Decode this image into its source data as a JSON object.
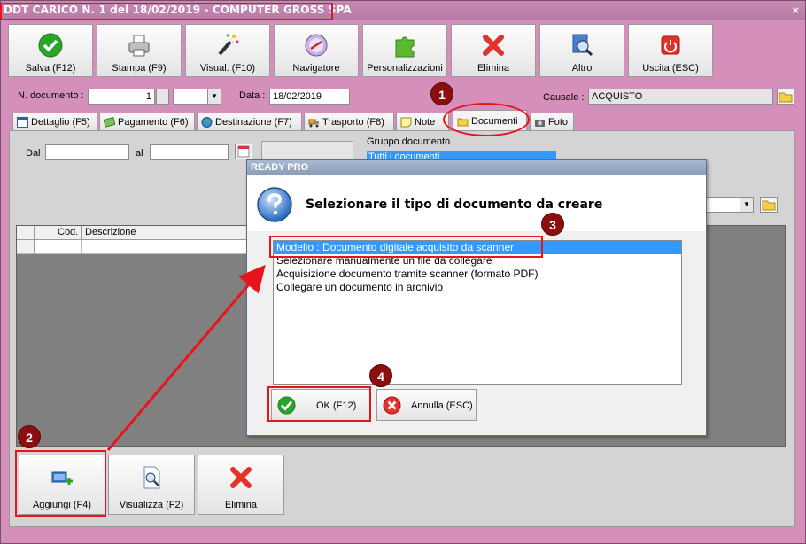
{
  "window": {
    "title": "DDT CARICO N. 1 del 18/02/2019 - COMPUTER GROSS SPA",
    "close_glyph": "×"
  },
  "toolbar": [
    {
      "label": "Salva (F12)",
      "icon": "check-icon"
    },
    {
      "label": "Stampa (F9)",
      "icon": "printer-icon"
    },
    {
      "label": "Visual. (F10)",
      "icon": "magic-wand-icon"
    },
    {
      "label": "Navigatore",
      "icon": "compass-icon"
    },
    {
      "label": "Personalizzazioni",
      "icon": "puzzle-icon"
    },
    {
      "label": "Elimina",
      "icon": "delete-icon"
    },
    {
      "label": "Altro",
      "icon": "magnifier-icon"
    },
    {
      "label": "Uscita (ESC)",
      "icon": "power-icon"
    }
  ],
  "form": {
    "ndoc_label": "N. documento :",
    "ndoc_value": "1",
    "data_label": "Data :",
    "data_value": "18/02/2019",
    "causale_label": "Causale :",
    "causale_value": "ACQUISTO"
  },
  "tabs": [
    {
      "label": "Dettaglio (F5)"
    },
    {
      "label": "Pagamento (F6)"
    },
    {
      "label": "Destinazione (F7)"
    },
    {
      "label": "Trasporto (F8)"
    },
    {
      "label": "Note"
    },
    {
      "label": "Documenti"
    },
    {
      "label": "Foto"
    }
  ],
  "documenti": {
    "dal_label": "Dal",
    "al_label": "al",
    "gruppo_label": "Gruppo documento",
    "gruppo_value": "Tutti i documenti",
    "columns": [
      "Cod.",
      "Descrizione"
    ]
  },
  "bottom_buttons": [
    {
      "label": "Aggiungi (F4)",
      "icon": "add-document-icon"
    },
    {
      "label": "Visualizza (F2)",
      "icon": "view-document-icon"
    },
    {
      "label": "Elimina",
      "icon": "delete-icon"
    }
  ],
  "dialog": {
    "title": "READY PRO",
    "message": "Selezionare il tipo di documento da creare",
    "options": [
      "Modello : Documento digitale acquisito da scanner",
      "Selezionare manualmente un file da collegare",
      "Acquisizione documento tramite scanner (formato PDF)",
      "Collegare un documento in archivio"
    ],
    "selected_index": 0,
    "ok_label": "OK (F12)",
    "cancel_label": "Annulla (ESC)"
  },
  "annotations": [
    "1",
    "2",
    "3",
    "4"
  ],
  "colors": {
    "window_bg": "#d58fbb",
    "highlight": "#e8141b",
    "badge": "#8b0f0f",
    "selection": "#3399ff"
  }
}
